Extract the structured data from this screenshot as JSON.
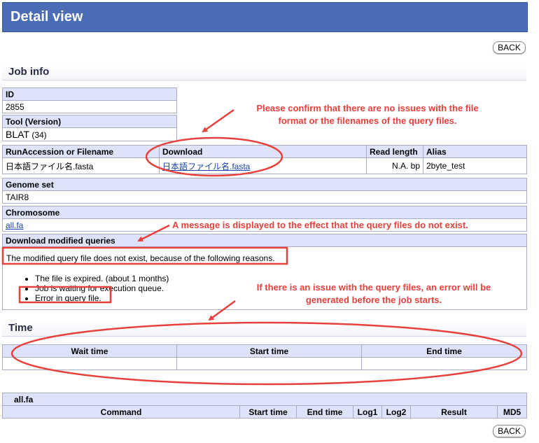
{
  "header": {
    "title": "Detail view"
  },
  "buttons": {
    "back_top": "BACK",
    "back_bottom": "BACK"
  },
  "job_info": {
    "section_title": "Job info",
    "id_label": "ID",
    "id_value": "2855",
    "tool_label": "Tool (Version)",
    "tool_name": "BLAT",
    "tool_version": "(34)",
    "files_headers": {
      "run": "RunAccession or Filename",
      "download": "Download",
      "read_length": "Read length",
      "alias": "Alias"
    },
    "files_row": {
      "run": "日本語ファイル名.fasta",
      "download": "日本語ファイル名.fasta",
      "read_length": "N.A. bp",
      "alias": "2byte_test"
    },
    "genome_label": "Genome set",
    "genome_value": "TAIR8",
    "chromosome_label": "Chromosome",
    "chromosome_value": "all.fa",
    "dmq_label": "Download modified queries",
    "dmq_message": "The modified query file does not exist, because of the following reasons.",
    "reasons": [
      "The file is expired. (about 1 months)",
      "Job is waiting for execution queue.",
      "Error in query file."
    ]
  },
  "time": {
    "section_title": "Time",
    "headers": [
      "Wait time",
      "Start time",
      "End time"
    ]
  },
  "commands": {
    "group_title": "all.fa",
    "headers": [
      "Command",
      "Start time",
      "End time",
      "Log1",
      "Log2",
      "Result",
      "MD5"
    ]
  },
  "annotations": {
    "note1_line1": "Please confirm that there are no issues with the file",
    "note1_line2": "format or the filenames of the query files.",
    "note2": "A message is displayed to the effect that the query files do not exist.",
    "note3_line1": "If there is an issue with the query files, an error will be",
    "note3_line2": "generated before the job starts."
  },
  "colors": {
    "titlebar": "#4a6db5",
    "annotation": "#e8403c",
    "header_cell": "#dfe3fa"
  }
}
